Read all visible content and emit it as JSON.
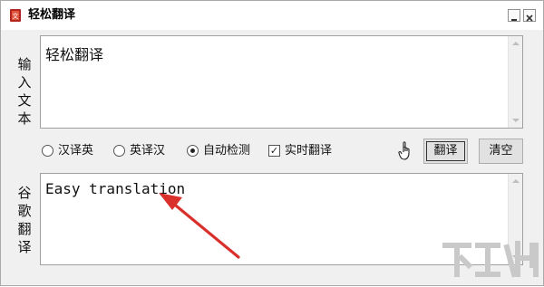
{
  "window": {
    "title": "轻松翻译"
  },
  "input": {
    "side_label": [
      "输",
      "入",
      "文",
      "本"
    ],
    "text": "轻松翻译"
  },
  "options": {
    "radios": [
      {
        "label": "汉译英",
        "selected": false
      },
      {
        "label": "英译汉",
        "selected": false
      },
      {
        "label": "自动检测",
        "selected": true
      }
    ],
    "checkbox": {
      "label": "实时翻译",
      "checked": true
    },
    "translate_button": "翻译",
    "clear_button": "清空"
  },
  "output": {
    "side_label": [
      "谷",
      "歌",
      "翻",
      "译"
    ],
    "text": "Easy translation"
  },
  "colors": {
    "arrow": "#d9302c",
    "background": "#f0f0f0"
  }
}
